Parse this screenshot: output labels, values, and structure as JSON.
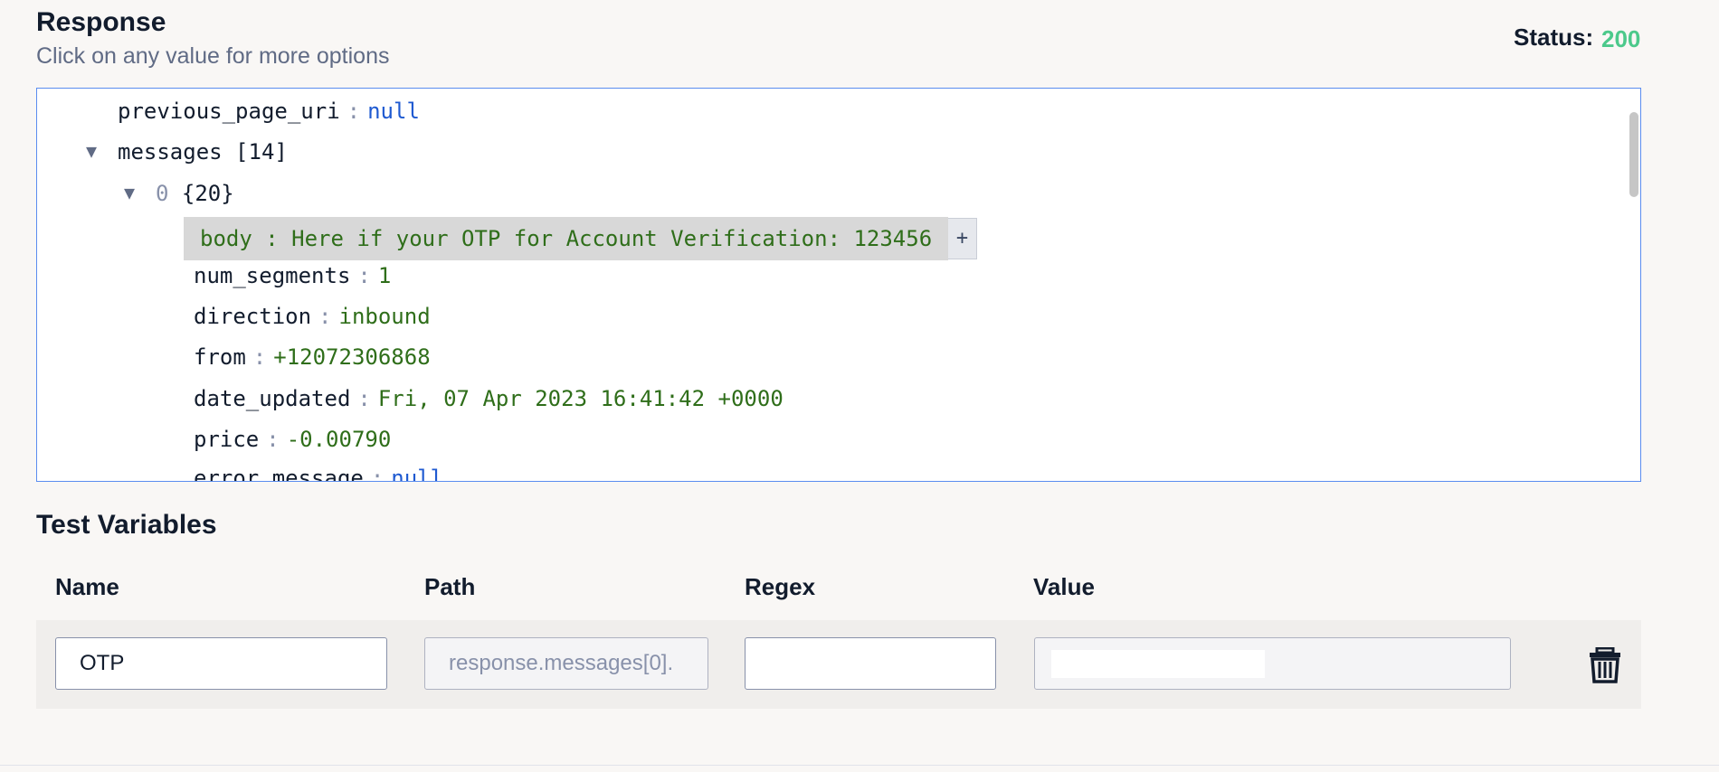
{
  "response": {
    "title": "Response",
    "subtitle": "Click on any value for more options",
    "status_label": "Status:",
    "status_value": "200"
  },
  "json_viewer": {
    "rows": {
      "previous_page_uri": {
        "key": "previous_page_uri",
        "sep": ":",
        "value": "null"
      },
      "messages": {
        "key": "messages",
        "count": "[14]",
        "arrow": "▼"
      },
      "item0": {
        "index": "0",
        "count": "{20}",
        "arrow": "▼"
      },
      "body": {
        "text": "body : Here if your OTP for Account Verification: 123456"
      },
      "num_segments": {
        "key": "num_segments",
        "sep": ":",
        "value": "1"
      },
      "direction": {
        "key": "direction",
        "sep": ":",
        "value": "inbound"
      },
      "from": {
        "key": "from",
        "sep": ":",
        "value": "+12072306868"
      },
      "date_updated": {
        "key": "date_updated",
        "sep": ":",
        "value": "Fri, 07 Apr 2023 16:41:42 +0000"
      },
      "price": {
        "key": "price",
        "sep": ":",
        "value": "-0.00790"
      },
      "error_message": {
        "key": "error_message",
        "sep": ":",
        "value": "null"
      }
    },
    "plus_label": "+"
  },
  "test_variables": {
    "title": "Test Variables",
    "columns": {
      "name": "Name",
      "path": "Path",
      "regex": "Regex",
      "value": "Value"
    },
    "row": {
      "name": "OTP",
      "path": "response.messages[0].",
      "regex": "",
      "value": ""
    }
  },
  "icons": {
    "delete": "trash-icon",
    "expand": "triangle-down-icon"
  },
  "colors": {
    "status_ok": "#4cc98b",
    "viewer_border": "#5b8def",
    "string_value": "#2f6e1a",
    "null_value": "#1f5ad1"
  }
}
